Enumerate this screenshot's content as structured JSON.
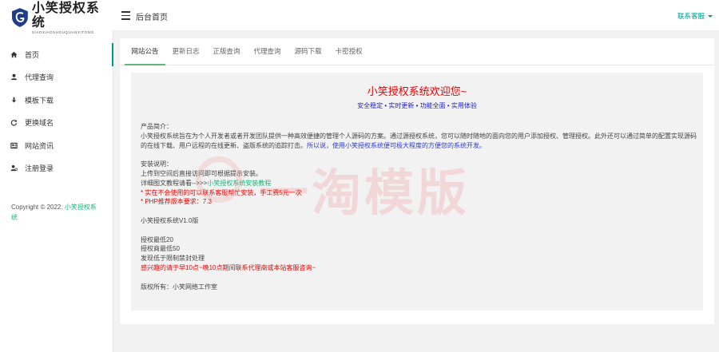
{
  "brand": {
    "title": "小笑授权系统",
    "subtitle": "XIAOXIAOSHOUQUANXITONG"
  },
  "sidebar": {
    "items": [
      {
        "label": "首页",
        "icon": "home-icon"
      },
      {
        "label": "代理查询",
        "icon": "user-icon"
      },
      {
        "label": "模板下载",
        "icon": "download-icon"
      },
      {
        "label": "更换域名",
        "icon": "refresh-icon"
      },
      {
        "label": "网站资讯",
        "icon": "news-icon"
      },
      {
        "label": "注册登录",
        "icon": "user-login-icon"
      }
    ],
    "copyright_prefix": "Copyright © 2022. ",
    "copyright_link": "小笑授权系统"
  },
  "topbar": {
    "title": "后台首页",
    "service": "联系客服"
  },
  "tabs": [
    "网站公告",
    "更新日志",
    "正版查询",
    "代理查询",
    "源码下载",
    "卡密授权"
  ],
  "notice": {
    "welcome": "小笑授权系统欢迎您~",
    "tagline": "安全稳定 • 实时更新 • 功能全面 • 实用体验",
    "intro_heading": "产品简介：",
    "intro_text": "小笑授权系统旨在为个人开发者或者开发团队提供一种高效便捷的管理个人源码的方案。通过源授权系统，您可以随时随地的面向您的用户添加授权、管理授权。此外还可以通过简单的配置实现源码的在线下载、用户远程的在线更新、盗版系统的追踪打击。",
    "intro_highlight": "所以说，使用小笑授权系统便可极大程度的方便您的系统开发。",
    "install_heading": "安装说明：",
    "install_line1": "上传到空间后直接访问即可根据提示安装。",
    "install_line2_prefix": "详细图文教程请看-->>>",
    "install_line2_link": "小笑授权系统安装教程",
    "install_line3": "* 实在不会使用的可以联系客服帮忙安装，手工费5元一次",
    "install_line4": "* PHP推荐版本要求：7.3",
    "version": "小笑授权系统V1.0版",
    "price1": "授权最低20",
    "price2": "授权商最低50",
    "price3": "发现低于限制禁封处理",
    "agent_note": "感兴趣的请于早10点~晚10点期间联系代理商或本站客服咨询~",
    "owner": "版权所有：小笑网络工作室"
  },
  "watermark": "一淘模版",
  "colors": {
    "accent": "#009688",
    "highlight_red": "#e00000",
    "highlight_blue": "#2a3bd3",
    "link_green": "#16b777"
  }
}
